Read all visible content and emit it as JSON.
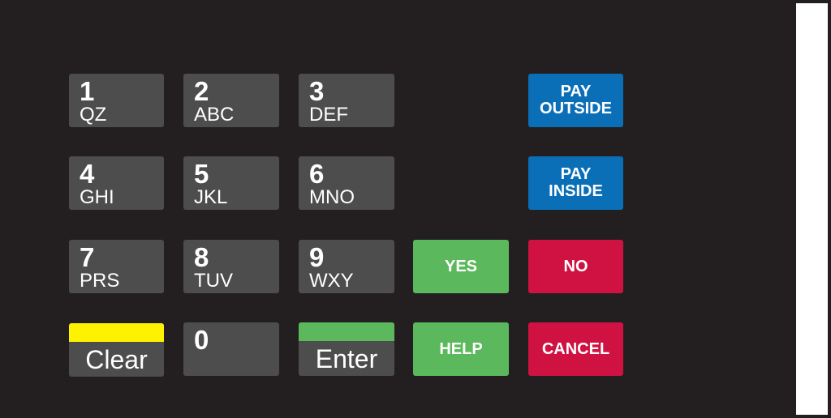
{
  "keypad": {
    "digits": [
      {
        "num": "1",
        "letters": "QZ"
      },
      {
        "num": "2",
        "letters": "ABC"
      },
      {
        "num": "3",
        "letters": "DEF"
      },
      {
        "num": "4",
        "letters": "GHI"
      },
      {
        "num": "5",
        "letters": "JKL"
      },
      {
        "num": "6",
        "letters": "MNO"
      },
      {
        "num": "7",
        "letters": "PRS"
      },
      {
        "num": "8",
        "letters": "TUV"
      },
      {
        "num": "9",
        "letters": "WXY"
      },
      {
        "num": "0",
        "letters": ""
      }
    ],
    "clear": {
      "label": "Clear",
      "band_color": "#fff200"
    },
    "enter": {
      "label": "Enter",
      "band_color": "#5cb85c"
    }
  },
  "function_keys": {
    "pay_outside": {
      "line1": "PAY",
      "line2": "OUTSIDE",
      "color": "#0a6fb7"
    },
    "pay_inside": {
      "line1": "PAY",
      "line2": "INSIDE",
      "color": "#0a6fb7"
    },
    "yes": {
      "label": "YES",
      "color": "#5cb85c"
    },
    "no": {
      "label": "NO",
      "color": "#cf1242"
    },
    "help": {
      "label": "HELP",
      "color": "#5cb85c"
    },
    "cancel": {
      "label": "CANCEL",
      "color": "#cf1242"
    }
  }
}
